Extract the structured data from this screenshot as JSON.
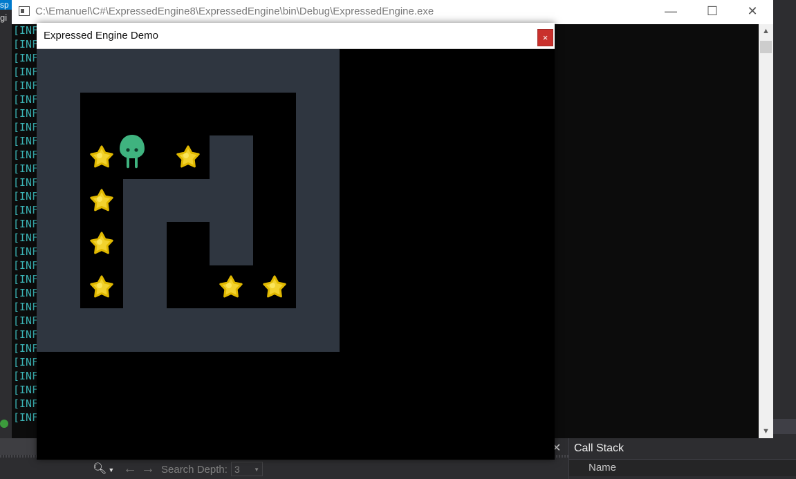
{
  "ide": {
    "tab_fragment": "sp",
    "left_fragment": "gi",
    "search_depth_label": "Search Depth:",
    "search_depth_value": "3",
    "callstack_title": "Call Stack",
    "callstack_column": "Name",
    "icons": [
      "search-icon",
      "arrow-left-icon",
      "arrow-right-icon",
      "close-icon"
    ]
  },
  "console": {
    "title": "C:\\Emanuel\\C#\\ExpressedEngine8\\ExpressedEngine\\bin\\Debug\\ExpressedEngine.exe",
    "log_lines": [
      "[INF",
      "[INF",
      "[INF",
      "[INF",
      "[INF",
      "[INF",
      "[INF",
      "[INF",
      "[INF",
      "[INF",
      "[INF",
      "[INF",
      "[INF",
      "[INF",
      "[INF",
      "[INF",
      "[INF",
      "[INF",
      "[INF",
      "[INF",
      "[INF",
      "[INF",
      "[INF",
      "[INF",
      "[INF",
      "[INF",
      "[INF",
      "[INF",
      "[INF"
    ],
    "log_color": "#3bb3b5",
    "window_buttons": {
      "minimize": "—",
      "maximize": "☐",
      "close": "✕"
    }
  },
  "game": {
    "title": "Expressed Engine Demo",
    "close_label": "×",
    "colors": {
      "wall": "#2f3640",
      "floor": "#000000",
      "star": "#f2d22e",
      "player": "#3fb37f"
    },
    "grid_cols": 7,
    "grid_rows": 7,
    "wall_tiles": [
      [
        0,
        0
      ],
      [
        1,
        0
      ],
      [
        2,
        0
      ],
      [
        3,
        0
      ],
      [
        4,
        0
      ],
      [
        5,
        0
      ],
      [
        6,
        0
      ],
      [
        0,
        1
      ],
      [
        6,
        1
      ],
      [
        0,
        2
      ],
      [
        4,
        2
      ],
      [
        6,
        2
      ],
      [
        0,
        3
      ],
      [
        2,
        3
      ],
      [
        3,
        3
      ],
      [
        4,
        3
      ],
      [
        6,
        3
      ],
      [
        0,
        4
      ],
      [
        2,
        4
      ],
      [
        4,
        4
      ],
      [
        6,
        4
      ],
      [
        0,
        5
      ],
      [
        2,
        5
      ],
      [
        6,
        5
      ],
      [
        0,
        6
      ],
      [
        1,
        6
      ],
      [
        2,
        6
      ],
      [
        3,
        6
      ],
      [
        4,
        6
      ],
      [
        5,
        6
      ],
      [
        6,
        6
      ]
    ],
    "stars": [
      [
        1,
        2
      ],
      [
        3,
        2
      ],
      [
        1,
        3
      ],
      [
        1,
        4
      ],
      [
        1,
        5
      ],
      [
        4,
        5
      ],
      [
        5,
        5
      ]
    ],
    "player": [
      2,
      2
    ]
  }
}
